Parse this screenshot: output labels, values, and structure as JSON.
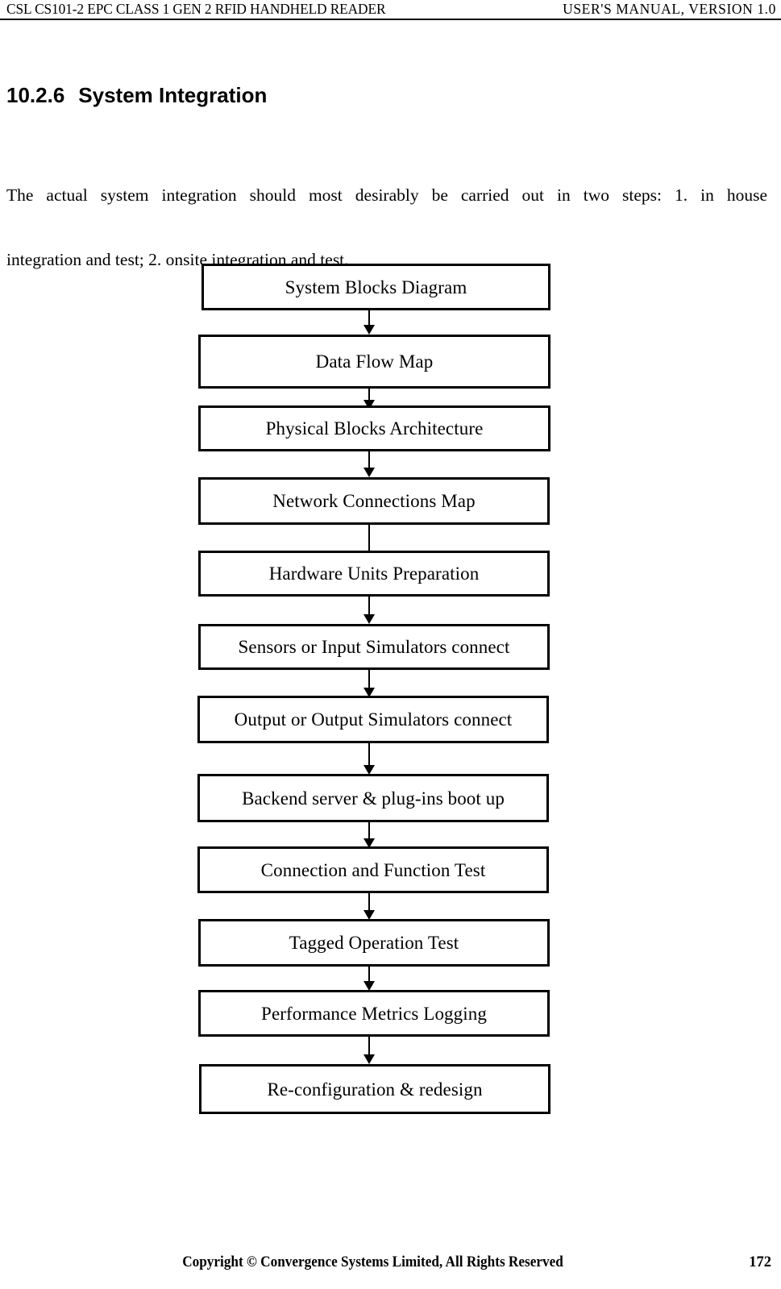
{
  "header": {
    "left_text": "CSL CS101-2 EPC CLASS 1 GEN 2 RFID HANDHELD READER",
    "right_text": "USER'S  MANUAL,  VERSION  1.0"
  },
  "section": {
    "number": "10.2.6",
    "title": "System Integration"
  },
  "body": {
    "line1": "The actual system integration should most desirably be carried out in two steps: 1. in house",
    "line2": "integration and test; 2. onsite integration and test."
  },
  "flowchart": {
    "type": "vertical-sequence-flowchart",
    "arrow_label": "down-arrow",
    "steps": [
      {
        "label": "System Blocks Diagram"
      },
      {
        "label": "Data Flow Map"
      },
      {
        "label": "Physical Blocks Architecture"
      },
      {
        "label": "Network Connections Map"
      },
      {
        "label": "Hardware Units Preparation"
      },
      {
        "label": "Sensors or Input Simulators connect"
      },
      {
        "label": "Output or Output Simulators connect"
      },
      {
        "label": "Backend server & plug-ins boot up"
      },
      {
        "label": "Connection and Function Test"
      },
      {
        "label": "Tagged Operation Test"
      },
      {
        "label": "Performance Metrics Logging"
      },
      {
        "label": "Re-configuration & redesign"
      }
    ]
  },
  "footer": {
    "copyright": "Copyright © Convergence Systems Limited, All Rights Reserved",
    "page_number": "172"
  },
  "colors": {
    "text": "#000000",
    "background": "#ffffff",
    "box_border": "#000000"
  }
}
